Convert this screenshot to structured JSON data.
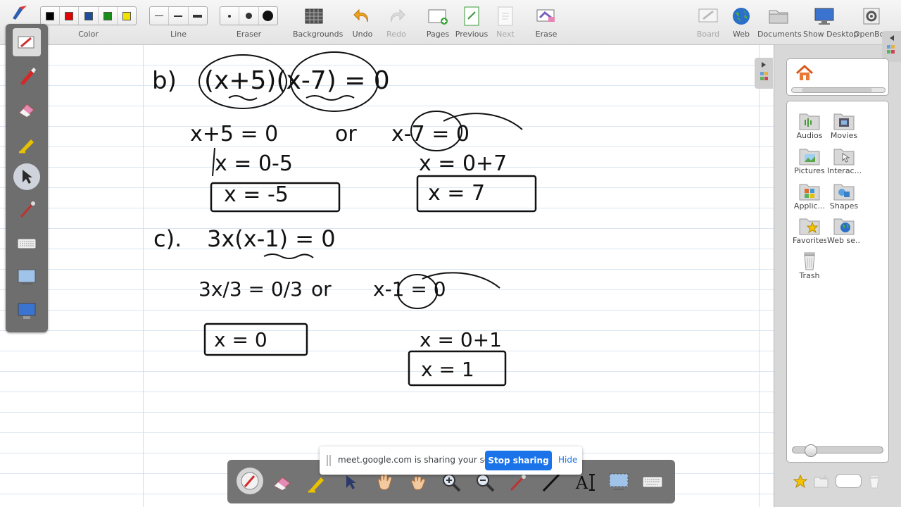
{
  "toolbar": {
    "color_label": "Color",
    "line_label": "Line",
    "eraser_label": "Eraser",
    "colors": [
      "#000000",
      "#e00000",
      "#1f4e9a",
      "#1a8c1a",
      "#f2e200"
    ],
    "buttons": {
      "backgrounds": "Backgrounds",
      "undo": "Undo",
      "redo": "Redo",
      "pages": "Pages",
      "previous": "Previous",
      "next": "Next",
      "erase": "Erase",
      "board": "Board",
      "web": "Web",
      "documents": "Documents",
      "show_desktop": "Show Desktop",
      "openboard": "OpenBoa"
    }
  },
  "left_tools": [
    "pen-icon",
    "marker-icon",
    "eraser-icon",
    "highlighter-icon",
    "selector-icon",
    "laser-pointer-icon",
    "keyboard-icon",
    "capture-icon",
    "desktop-icon"
  ],
  "library": {
    "items": [
      {
        "label": "Audios",
        "icon": "audio-folder-icon"
      },
      {
        "label": "Movies",
        "icon": "movie-folder-icon"
      },
      {
        "label": "Pictures",
        "icon": "picture-folder-icon"
      },
      {
        "label": "Interac...",
        "icon": "interactive-folder-icon"
      },
      {
        "label": "Applic...",
        "icon": "application-folder-icon"
      },
      {
        "label": "Shapes",
        "icon": "shapes-folder-icon"
      },
      {
        "label": "Favorites",
        "icon": "favorites-folder-icon"
      },
      {
        "label": "Web se...",
        "icon": "web-search-folder-icon"
      },
      {
        "label": "Trash",
        "icon": "trash-icon"
      }
    ]
  },
  "bottom_tools": [
    "pen-icon",
    "eraser-icon",
    "marker-icon",
    "selector-icon",
    "hand-icon",
    "grab-icon",
    "zoom-in-icon",
    "zoom-out-icon",
    "pointer-icon",
    "line-icon",
    "text-icon",
    "capture-icon",
    "keyboard-icon"
  ],
  "share_notice": {
    "message": "meet.google.com is sharing your screen.",
    "stop_label": "Stop sharing",
    "hide_label": "Hide"
  },
  "handwriting": {
    "b_label": "b)",
    "b_eq": "(x+5)(x-7) = 0",
    "b_step1_left": "x+5 = 0",
    "or_word": "or",
    "b_step1_right": "x-7 = 0",
    "b_step2_left": "x = 0-5",
    "b_step2_right": "x = 0+7",
    "b_ans_left": "x = -5",
    "b_ans_right": "x = 7",
    "c_label": "c).",
    "c_eq": "3x(x-1) = 0",
    "c_step1_left": "3x/3 = 0/3",
    "c_step1_right": "x-1 = 0",
    "c_step2_right": "x = 0+1",
    "c_ans_left": "x = 0",
    "c_ans_right": "x = 1"
  }
}
